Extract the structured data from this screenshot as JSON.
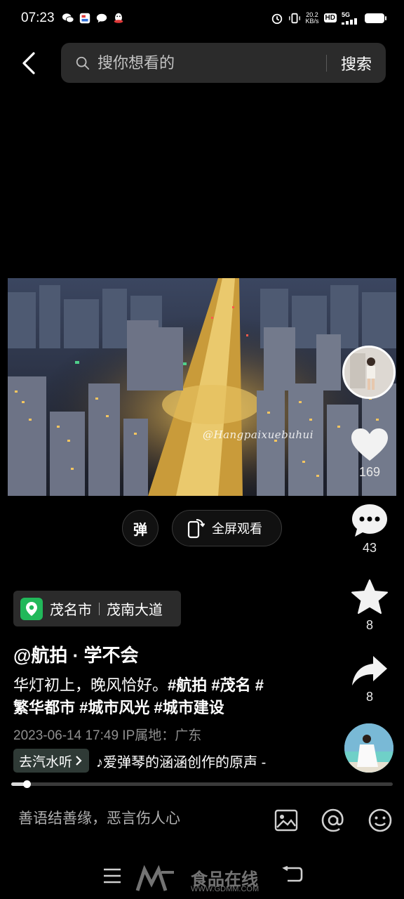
{
  "status_bar": {
    "time": "07:23",
    "net_speed_value": "20.2",
    "net_speed_unit": "KB/s",
    "hd_label": "HD",
    "network_label": "5G"
  },
  "search": {
    "placeholder": "搜你想看的",
    "button_label": "搜索"
  },
  "video": {
    "watermark": "@Hangpaixuebuhui"
  },
  "controls": {
    "danmaku_label": "弹",
    "fullscreen_label": "全屏观看"
  },
  "rail": {
    "likes": "169",
    "comments": "43",
    "favorites": "8",
    "shares": "8"
  },
  "location": {
    "city": "茂名市",
    "road": "茂南大道"
  },
  "post": {
    "author": "@航拍 · 学不会",
    "caption_text": "华灯初上，晚风恰好。",
    "tag1": "#航拍",
    "tag2": "#茂名",
    "tag3": "#",
    "tag4": "繁华都市",
    "tag5": "#城市风光",
    "tag6": "#城市建设",
    "datetime": "2023-06-14 17:49",
    "ip_location": "IP属地：广东"
  },
  "music": {
    "chip_label": "去汽水听",
    "track": "♪爱弹琴的涵涵创作的原声 -"
  },
  "progress": {
    "fraction": 0.04
  },
  "comment_bar": {
    "placeholder": "善语结善缘，恶言伤人心"
  },
  "site_watermark": {
    "name": "食品在线",
    "url": "WWW.GDMM.COM"
  },
  "colors": {
    "background": "#000000",
    "location_green": "#21b85a",
    "chip_bg": "#2b2b2b"
  }
}
